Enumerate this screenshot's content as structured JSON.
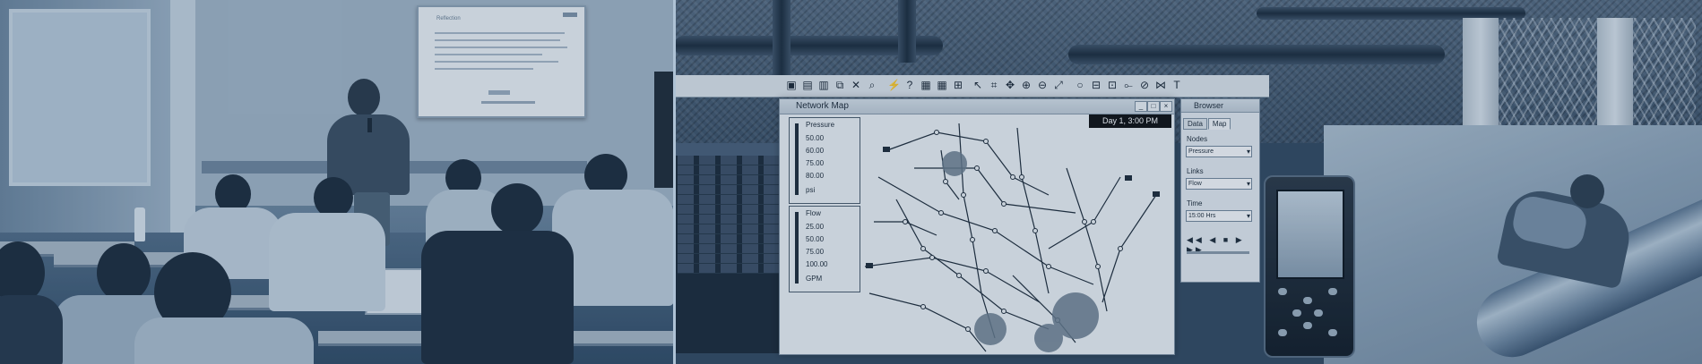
{
  "classroom": {
    "board_title": "Reflection"
  },
  "app": {
    "network_map": {
      "window_title": "Network Map",
      "time_display": "Day 1, 3:00 PM",
      "pressure_legend": {
        "title": "Pressure",
        "values": [
          "50.00",
          "60.00",
          "75.00",
          "80.00"
        ],
        "unit": "psi"
      },
      "flow_legend": {
        "title": "Flow",
        "values": [
          "25.00",
          "50.00",
          "75.00",
          "100.00"
        ],
        "unit": "GPM"
      }
    },
    "browser": {
      "title": "Browser",
      "tabs": [
        "Data",
        "Map"
      ],
      "active_tab": "Map",
      "nodes_label": "Nodes",
      "nodes_value": "Pressure",
      "links_label": "Links",
      "links_value": "Flow",
      "time_label": "Time",
      "time_value": "15:00 Hrs",
      "playback": "◀◀ ◀ ■ ▶ ▶▶"
    }
  }
}
